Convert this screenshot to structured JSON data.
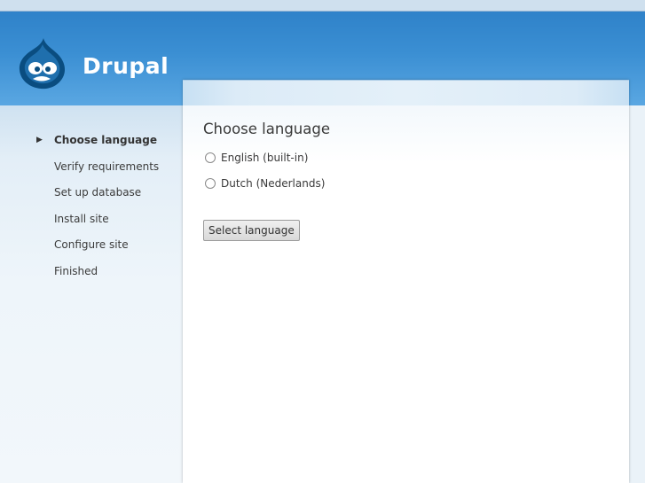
{
  "header": {
    "site_name": "Drupal",
    "logo_icon": "drupal-drop-logo",
    "colors": {
      "header_blue": "#3b8fd3",
      "text_white": "#ffffff"
    }
  },
  "sidebar": {
    "tasks": [
      {
        "label": "Choose language",
        "active": true
      },
      {
        "label": "Verify requirements",
        "active": false
      },
      {
        "label": "Set up database",
        "active": false
      },
      {
        "label": "Install site",
        "active": false
      },
      {
        "label": "Configure site",
        "active": false
      },
      {
        "label": "Finished",
        "active": false
      }
    ],
    "active_marker": "▶"
  },
  "main": {
    "title": "Choose language",
    "options": [
      {
        "label": "English (built-in)",
        "selected": false
      },
      {
        "label": "Dutch (Nederlands)",
        "selected": false
      }
    ],
    "submit_label": "Select language"
  }
}
